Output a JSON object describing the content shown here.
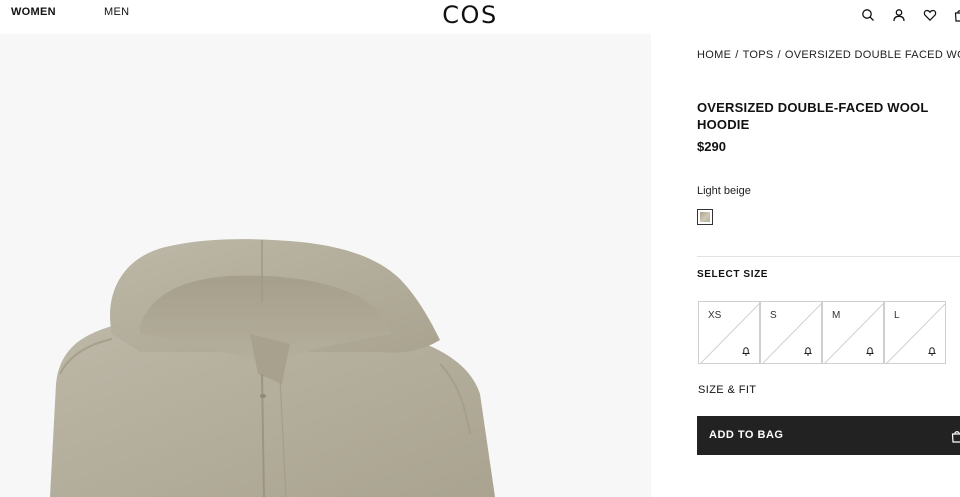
{
  "header": {
    "nav": [
      "WOMEN",
      "MEN"
    ],
    "logo": "COS",
    "icons": [
      "search-icon",
      "account-icon",
      "wishlist-icon",
      "bag-icon"
    ]
  },
  "breadcrumb": [
    "HOME",
    "TOPS",
    "OVERSIZED DOUBLE FACED WOOL H"
  ],
  "breadcrumb_separator": "/",
  "product": {
    "title": "OVERSIZED DOUBLE-FACED WOOL HOODIE",
    "price": "$290",
    "color_name": "Light beige",
    "swatch_color": "#bfb8a5"
  },
  "sizes": {
    "heading": "SELECT SIZE",
    "options": [
      {
        "label": "XS",
        "available": false
      },
      {
        "label": "S",
        "available": false
      },
      {
        "label": "M",
        "available": false
      },
      {
        "label": "L",
        "available": false
      }
    ],
    "size_fit_label": "SIZE & FIT"
  },
  "cta": {
    "add_to_bag_label": "ADD TO BAG",
    "background": "#222222"
  }
}
